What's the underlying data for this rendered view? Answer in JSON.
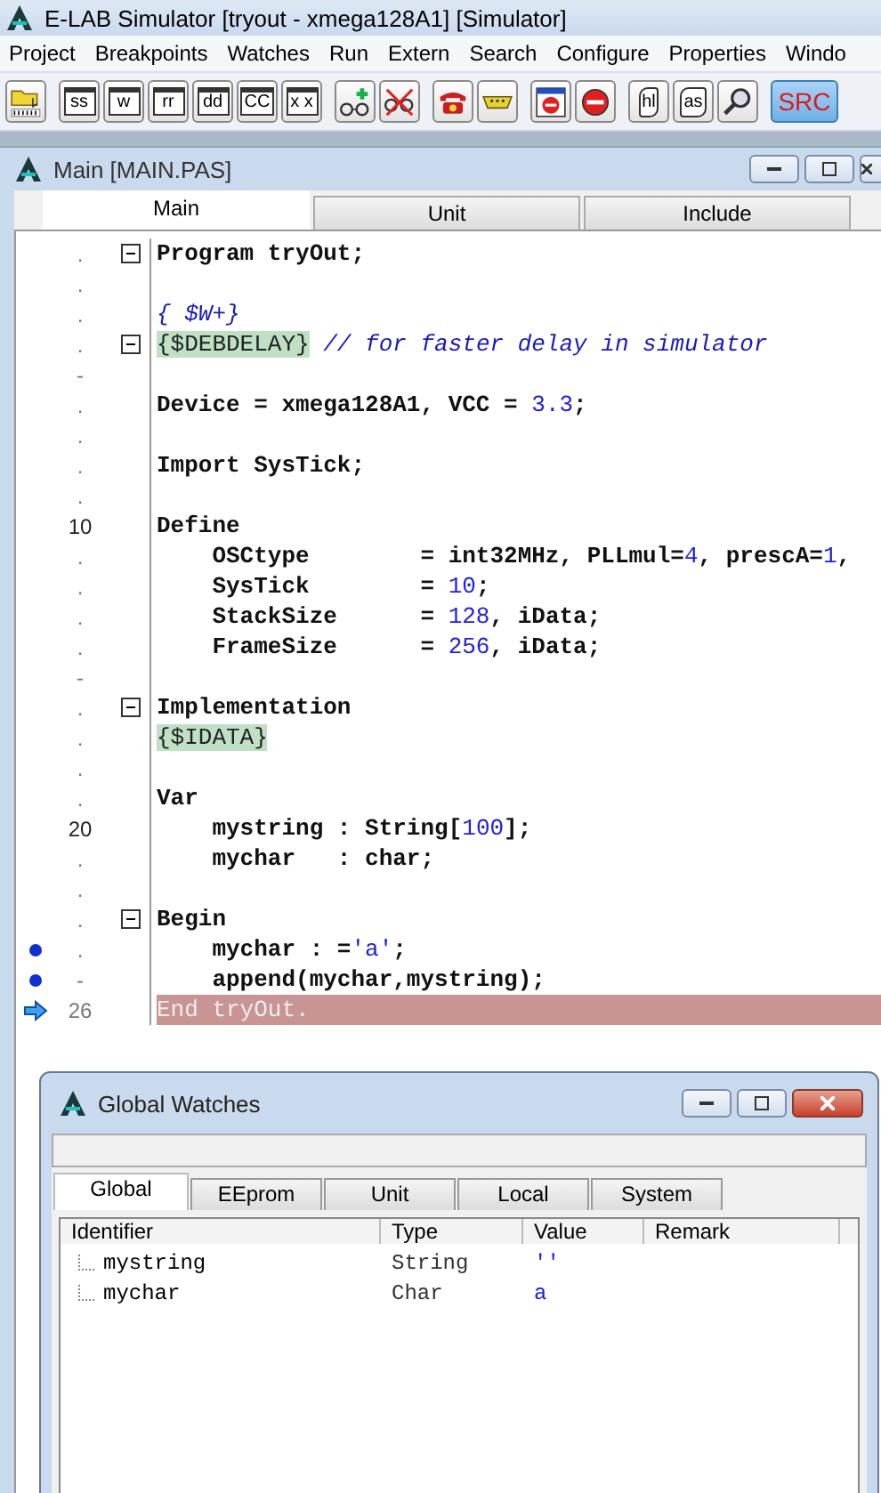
{
  "app": {
    "title": "E-LAB Simulator [tryout - xmega128A1] [Simulator]"
  },
  "menu": [
    "Project",
    "Breakpoints",
    "Watches",
    "Run",
    "Extern",
    "Search",
    "Configure",
    "Properties",
    "Windo"
  ],
  "toolbar": [
    {
      "kind": "folder"
    },
    {
      "kind": "window",
      "label": "ss"
    },
    {
      "kind": "window",
      "label": "w"
    },
    {
      "kind": "window",
      "label": "rr"
    },
    {
      "kind": "window",
      "label": "dd"
    },
    {
      "kind": "window",
      "label": "CC"
    },
    {
      "kind": "window",
      "label": "x x"
    },
    {
      "kind": "glasses-add"
    },
    {
      "kind": "glasses-remove"
    },
    {
      "kind": "phone"
    },
    {
      "kind": "connector"
    },
    {
      "kind": "window-stop"
    },
    {
      "kind": "stop"
    },
    {
      "kind": "scroll",
      "label": "hl"
    },
    {
      "kind": "scroll",
      "label": "as"
    },
    {
      "kind": "magnifier"
    },
    {
      "kind": "text",
      "label": "SRC"
    }
  ],
  "editor": {
    "title": "Main [MAIN.PAS]",
    "tabs": [
      {
        "label": "Main",
        "selected": true
      },
      {
        "label": "Unit",
        "selected": false
      },
      {
        "label": "Include",
        "selected": false
      }
    ],
    "lines": [
      {
        "gutter": ".",
        "fold": true,
        "breakpoint": false,
        "current": false,
        "segments": [
          {
            "text": "Program tryOut;",
            "kind": "plain"
          }
        ]
      },
      {
        "gutter": ".",
        "fold": false,
        "breakpoint": false,
        "current": false
      },
      {
        "gutter": ".",
        "fold": false,
        "breakpoint": false,
        "current": false,
        "segments": [
          {
            "text": "{ $W+}",
            "kind": "comment"
          }
        ]
      },
      {
        "gutter": ".",
        "fold": true,
        "breakpoint": false,
        "current": false,
        "segments": [
          {
            "text": "{$DEBDELAY}",
            "kind": "directive"
          },
          {
            "text": "// for faster delay in simulator",
            "kind": "comment"
          }
        ]
      },
      {
        "gutter": "-",
        "fold": false,
        "breakpoint": false,
        "current": false
      },
      {
        "gutter": ".",
        "fold": false,
        "breakpoint": false,
        "current": false,
        "segments": [
          {
            "text": "Device = xmega128A1, VCC = ",
            "kind": "plain"
          },
          {
            "text": "3.3",
            "kind": "number"
          },
          {
            "text": ";",
            "kind": "plain"
          }
        ]
      },
      {
        "gutter": ".",
        "fold": false,
        "breakpoint": false,
        "current": false
      },
      {
        "gutter": ".",
        "fold": false,
        "breakpoint": false,
        "current": false,
        "segments": [
          {
            "text": "Import SysTick;",
            "kind": "plain"
          }
        ]
      },
      {
        "gutter": ".",
        "fold": false,
        "breakpoint": false,
        "current": false
      },
      {
        "gutter": "10",
        "fold": false,
        "breakpoint": false,
        "current": false,
        "segments": [
          {
            "text": "Define",
            "kind": "plain"
          }
        ]
      },
      {
        "gutter": ".",
        "fold": false,
        "breakpoint": false,
        "current": false,
        "segments": [
          {
            "text": "    OSCtype        = int32MHz, PLLmul=",
            "kind": "plain"
          },
          {
            "text": "4",
            "kind": "number"
          },
          {
            "text": ", prescA=",
            "kind": "plain"
          },
          {
            "text": "1",
            "kind": "number"
          },
          {
            "text": ",",
            "kind": "plain"
          }
        ]
      },
      {
        "gutter": ".",
        "fold": false,
        "breakpoint": false,
        "current": false,
        "segments": [
          {
            "text": "    SysTick        = ",
            "kind": "plain"
          },
          {
            "text": "10",
            "kind": "number"
          },
          {
            "text": ";",
            "kind": "plain"
          }
        ]
      },
      {
        "gutter": ".",
        "fold": false,
        "breakpoint": false,
        "current": false,
        "segments": [
          {
            "text": "    StackSize      = ",
            "kind": "plain"
          },
          {
            "text": "128",
            "kind": "number"
          },
          {
            "text": ", iData;",
            "kind": "plain"
          }
        ]
      },
      {
        "gutter": ".",
        "fold": false,
        "breakpoint": false,
        "current": false,
        "segments": [
          {
            "text": "    FrameSize      = ",
            "kind": "plain"
          },
          {
            "text": "256",
            "kind": "number"
          },
          {
            "text": ", iData;",
            "kind": "plain"
          }
        ]
      },
      {
        "gutter": "-",
        "fold": false,
        "breakpoint": false,
        "current": false
      },
      {
        "gutter": ".",
        "fold": true,
        "breakpoint": false,
        "current": false,
        "segments": [
          {
            "text": "Implementation",
            "kind": "plain"
          }
        ]
      },
      {
        "gutter": ".",
        "fold": false,
        "breakpoint": false,
        "current": false,
        "segments": [
          {
            "text": "{$IDATA}",
            "kind": "directive"
          }
        ]
      },
      {
        "gutter": ".",
        "fold": false,
        "breakpoint": false,
        "current": false
      },
      {
        "gutter": ".",
        "fold": false,
        "breakpoint": false,
        "current": false,
        "segments": [
          {
            "text": "Var",
            "kind": "plain"
          }
        ]
      },
      {
        "gutter": "20",
        "fold": false,
        "breakpoint": false,
        "current": false,
        "segments": [
          {
            "text": "    mystring : String[",
            "kind": "plain"
          },
          {
            "text": "100",
            "kind": "number"
          },
          {
            "text": "];",
            "kind": "plain"
          }
        ]
      },
      {
        "gutter": ".",
        "fold": false,
        "breakpoint": false,
        "current": false,
        "segments": [
          {
            "text": "    mychar   : char;",
            "kind": "plain"
          }
        ]
      },
      {
        "gutter": ".",
        "fold": false,
        "breakpoint": false,
        "current": false
      },
      {
        "gutter": ".",
        "fold": true,
        "breakpoint": false,
        "current": false,
        "segments": [
          {
            "text": "Begin",
            "kind": "plain"
          }
        ]
      },
      {
        "gutter": ".",
        "fold": false,
        "breakpoint": true,
        "current": false,
        "segments": [
          {
            "text": "    mychar : =",
            "kind": "plain"
          },
          {
            "text": "'a'",
            "kind": "number"
          },
          {
            "text": ";",
            "kind": "plain"
          }
        ]
      },
      {
        "gutter": "-",
        "fold": false,
        "breakpoint": true,
        "current": false,
        "segments": [
          {
            "text": "    append(mychar,mystring);",
            "kind": "plain"
          }
        ]
      },
      {
        "gutter": "26",
        "fold": false,
        "breakpoint": false,
        "current": true,
        "segments": [
          {
            "text": "End tryOut.",
            "kind": "plain"
          }
        ]
      }
    ]
  },
  "watches": {
    "title": "Global Watches",
    "tabs": [
      {
        "label": "Global",
        "selected": true
      },
      {
        "label": "EEprom",
        "selected": false
      },
      {
        "label": "Unit",
        "selected": false
      },
      {
        "label": "Local",
        "selected": false
      },
      {
        "label": "System",
        "selected": false
      }
    ],
    "columns": [
      "Identifier",
      "Type",
      "Value",
      "Remark"
    ],
    "rows": [
      {
        "identifier": "mystring",
        "type": "String",
        "value": "''"
      },
      {
        "identifier": "mychar",
        "type": "Char",
        "value": "a"
      }
    ]
  }
}
